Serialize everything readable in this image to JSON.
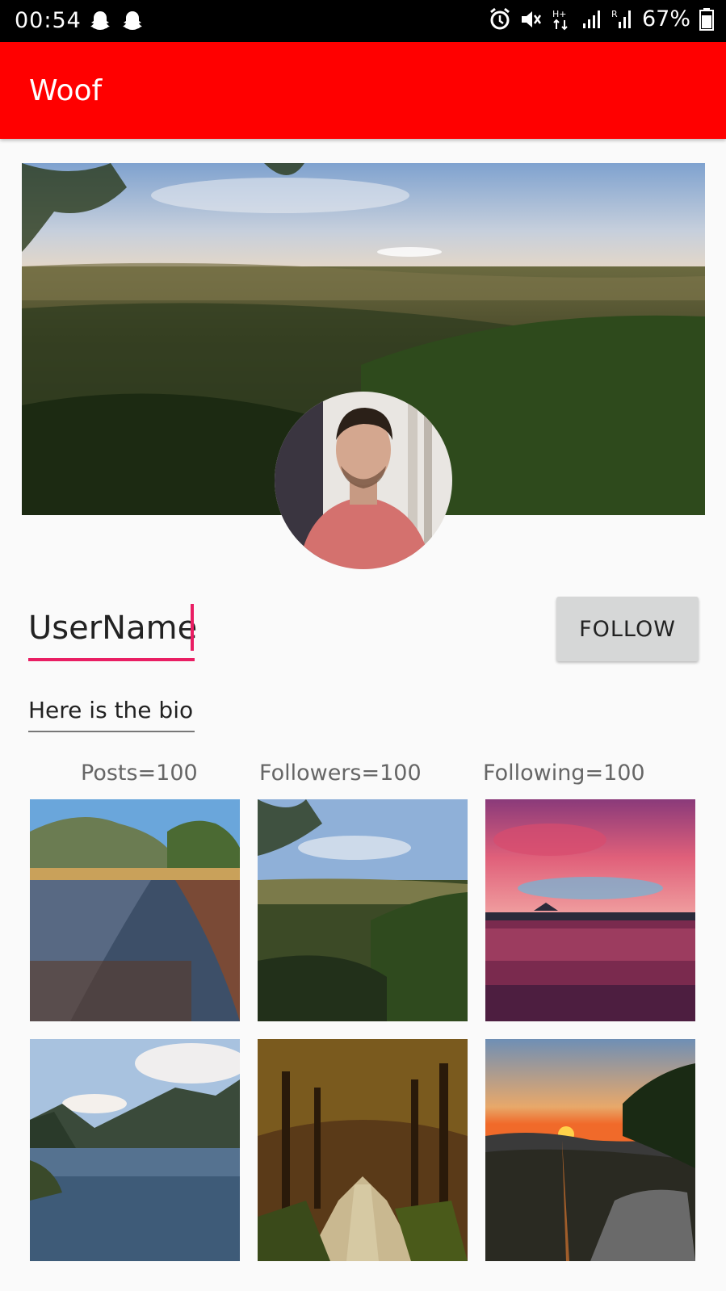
{
  "status_bar": {
    "time": "00:54",
    "battery": "67%",
    "left_icons": [
      "snapchat-ghost-icon",
      "snapchat-ghost-icon"
    ],
    "right_icons": [
      "alarm-icon",
      "mute-icon",
      "hplus-data-icon",
      "signal-icon",
      "roaming-signal-icon",
      "battery-icon"
    ]
  },
  "app_bar": {
    "title": "Woof",
    "color": "#ff0000"
  },
  "profile": {
    "username": "UserName",
    "follow_label": "FOLLOW",
    "bio": "Here is the bio",
    "accent": "#e91e63"
  },
  "stats": {
    "posts": "Posts=100",
    "followers": "Followers=100",
    "following": "Following=100"
  },
  "photos": [
    "lake-reflection",
    "forest-valley",
    "sunset-lake",
    "mountain-lake",
    "tree-avenue",
    "mountain-sunset"
  ]
}
